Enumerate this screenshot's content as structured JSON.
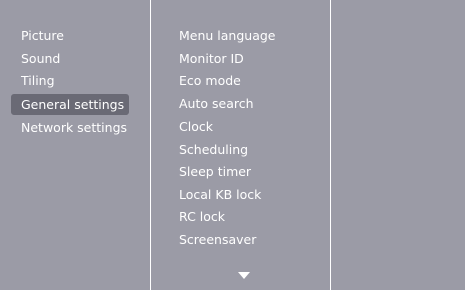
{
  "main_menu": {
    "items": [
      {
        "label": "Picture"
      },
      {
        "label": "Sound"
      },
      {
        "label": "Tiling"
      },
      {
        "label": "General settings",
        "selected": true
      },
      {
        "label": "Network settings"
      }
    ]
  },
  "submenu": {
    "items": [
      {
        "label": "Menu language"
      },
      {
        "label": "Monitor ID"
      },
      {
        "label": "Eco mode"
      },
      {
        "label": "Auto search"
      },
      {
        "label": "Clock"
      },
      {
        "label": "Scheduling"
      },
      {
        "label": "Sleep timer"
      },
      {
        "label": "Local KB lock"
      },
      {
        "label": "RC lock"
      },
      {
        "label": "Screensaver"
      }
    ],
    "more_indicator": "chevron-down-icon"
  },
  "colors": {
    "panel_background": "#9b9ba6",
    "selection_highlight": "#6a6a75",
    "text": "#ffffff",
    "divider": "#ffffff"
  }
}
